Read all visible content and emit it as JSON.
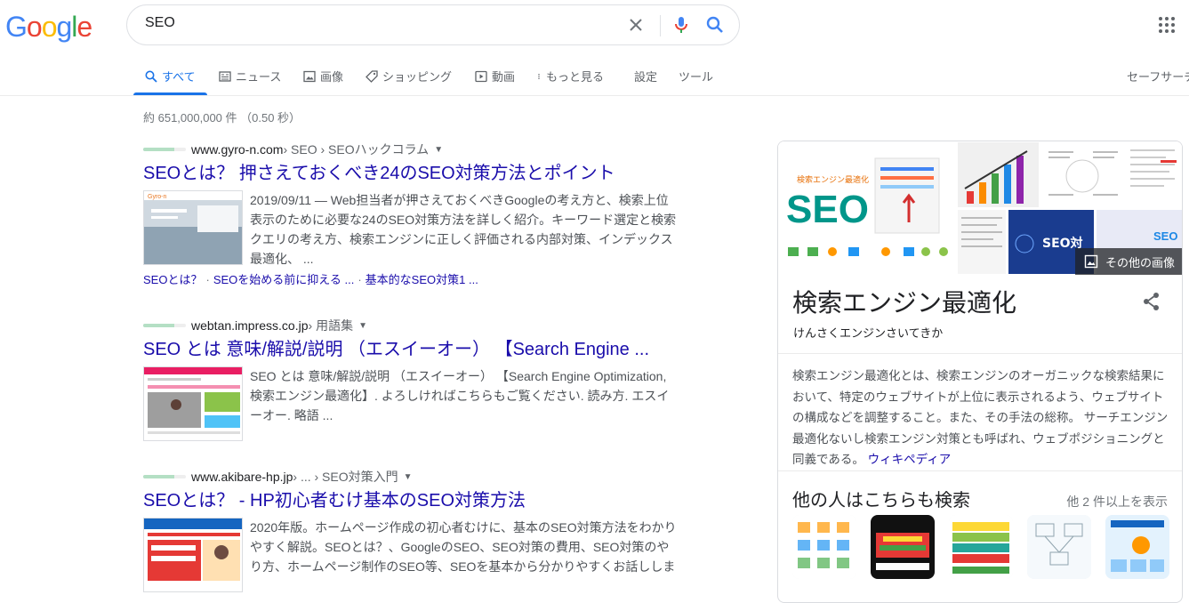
{
  "header": {
    "logo_letters": [
      "G",
      "o",
      "o",
      "g",
      "l",
      "e"
    ],
    "search_value": "SEO",
    "icons": {
      "clear": "close-icon",
      "mic": "mic-icon",
      "search": "search-icon",
      "apps": "apps-grid-icon"
    }
  },
  "tabs": [
    {
      "label": "すべて",
      "icon": "search-icon",
      "active": true
    },
    {
      "label": "ニュース",
      "icon": "news-icon"
    },
    {
      "label": "画像",
      "icon": "image-icon"
    },
    {
      "label": "ショッピング",
      "icon": "tag-icon"
    },
    {
      "label": "動画",
      "icon": "video-icon"
    },
    {
      "label": "もっと見る",
      "icon": "more-vert-icon"
    },
    {
      "label": "設定"
    },
    {
      "label": "ツール"
    },
    {
      "label": "セーフサーチ"
    }
  ],
  "result_stats": "約 651,000,000 件 （0.50 秒）",
  "results": [
    {
      "domain": "www.gyro-n.com",
      "path": " › SEO › SEOハックコラム",
      "title": "SEOとは？ 押さえておくべき24のSEO対策方法とポイント",
      "snippet": "2019/09/11 — Web担当者が押さえておくべきGoogleの考え方と、検索上位表示のために必要な24のSEO対策方法を詳しく紹介。キーワード選定と検索クエリの考え方、検索エンジンに正しく評価される内部対策、インデックス最適化、 ...",
      "sitelinks": [
        "SEOとは？",
        "SEOを始める前に抑える ...",
        "基本的なSEO対策1 ..."
      ]
    },
    {
      "domain": "webtan.impress.co.jp",
      "path": " › 用語集",
      "title": "SEO とは 意味/解説/説明 （エスイーオー） 【Search Engine ...",
      "snippet": "SEO とは 意味/解説/説明 （エスイーオー） 【Search Engine Optimization, 検索エンジン最適化】. よろしければこちらもご覧ください. 読み方. エスイーオー. 略語 ..."
    },
    {
      "domain": "www.akibare-hp.jp",
      "path": " › ... › SEO対策入門",
      "title": "SEOとは？ - HP初心者むけ基本のSEO対策方法",
      "snippet": "2020年版。ホームページ作成の初心者むけに、基本のSEO対策方法をわかりやすく解説。SEOとは？、GoogleのSEO、SEO対策の費用、SEO対策のやり方、ホームページ制作のSEO等、SEOを基本から分かりやすくお話ししま"
    }
  ],
  "knowledge_panel": {
    "image_main_text": "SEO",
    "image_main_caption": "検索エンジン最適化",
    "image_side_text": "SEO対",
    "more_images": "その他の画像",
    "title": "検索エンジン最適化",
    "subtitle": "けんさくエンジンさいてきか",
    "description": "検索エンジン最適化とは、検索エンジンのオーガニックな検索結果において、特定のウェブサイトが上位に表示されるよう、ウェブサイトの構成などを調整すること。また、その手法の総称。 サーチエンジン最適化ないし検索エンジン対策とも呼ばれ、ウェブポジショニングと同義である。",
    "source_link": "ウィキペディア",
    "pasf_title": "他の人はこちらも検索",
    "pasf_more": "他 2 件以上を表示"
  },
  "colors": {
    "link": "#1a0dab",
    "accent": "#1a73e8",
    "snippet": "#4d5156"
  }
}
